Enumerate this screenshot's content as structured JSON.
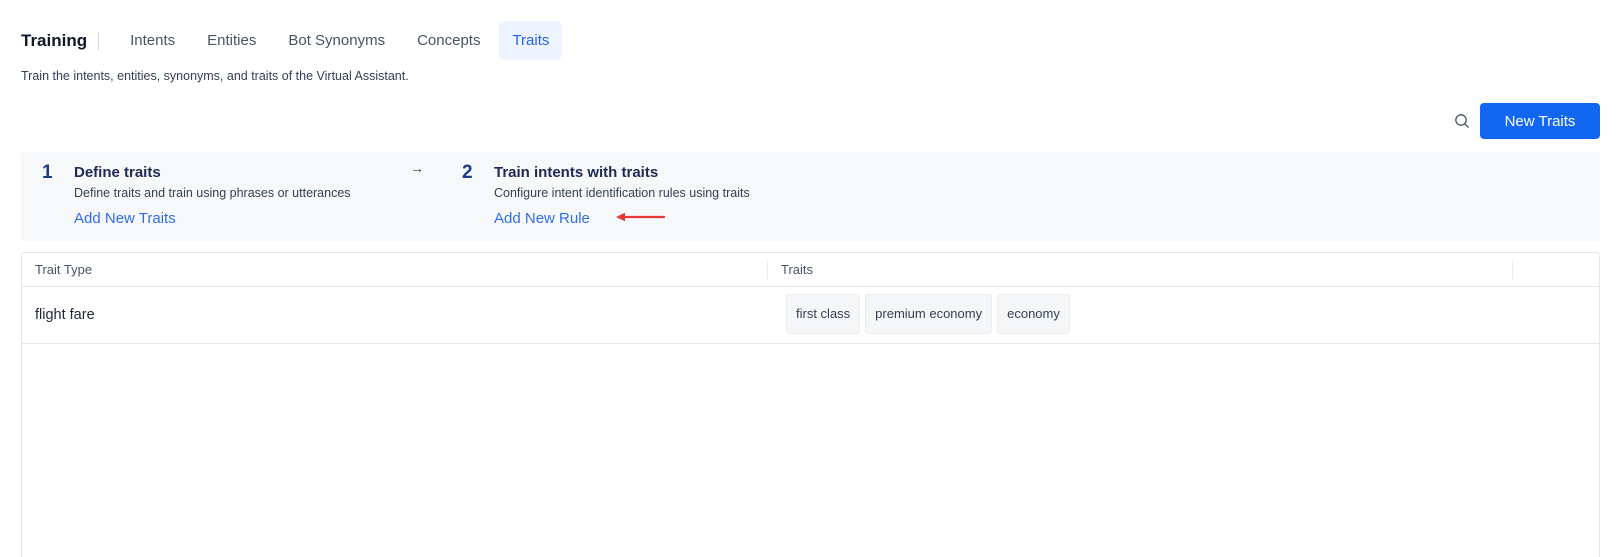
{
  "header": {
    "section_title": "Training",
    "tabs": [
      {
        "label": "Intents",
        "active": false
      },
      {
        "label": "Entities",
        "active": false
      },
      {
        "label": "Bot Synonyms",
        "active": false
      },
      {
        "label": "Concepts",
        "active": false
      },
      {
        "label": "Traits",
        "active": true
      }
    ],
    "subtitle": "Train the intents, entities, synonyms, and traits of the Virtual Assistant."
  },
  "toolbar": {
    "search_icon": "search-icon",
    "new_button_label": "New Traits"
  },
  "steps": [
    {
      "number": "1",
      "title": "Define traits",
      "description": "Define traits and train using phrases or utterances",
      "link": "Add New Traits"
    },
    {
      "number": "2",
      "title": "Train intents with traits",
      "description": "Configure intent identification rules using traits",
      "link": "Add New Rule"
    }
  ],
  "table": {
    "columns": [
      "Trait Type",
      "Traits"
    ],
    "rows": [
      {
        "trait_type": "flight fare",
        "traits": [
          "first class",
          "premium economy",
          "economy"
        ]
      }
    ]
  },
  "colors": {
    "accent": "#1167f2",
    "link": "#2f6ee8",
    "active_tab_bg": "#eef4ff",
    "annotation_arrow": "#e53935"
  }
}
